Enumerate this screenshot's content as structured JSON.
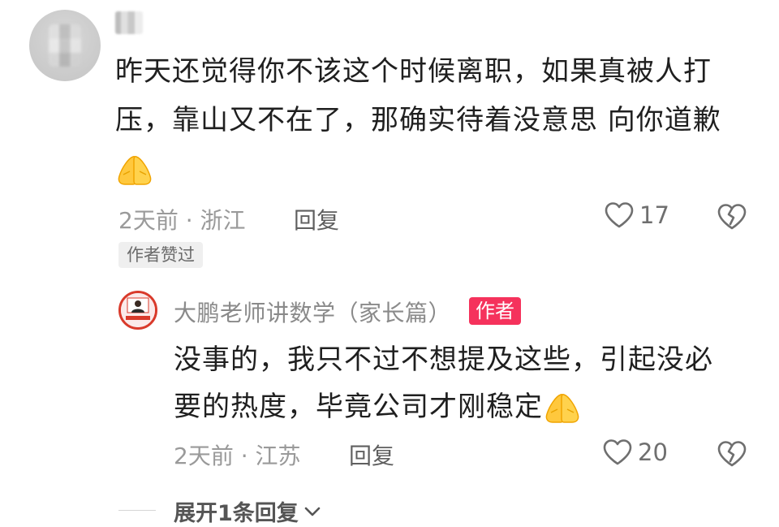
{
  "comment": {
    "text_line1": "昨天还觉得你不该这个时候离职，如果真被人打",
    "text_line2": "压，靠山又不在了，那确实待着没意思 向你道歉",
    "emoji": "folded-hands-emoji",
    "time_location": "2天前 · 浙江",
    "reply_label": "回复",
    "like_count": "17",
    "author_liked": "作者赞过"
  },
  "reply": {
    "author_name": "大鹏老师讲数学（家长篇）",
    "author_tag": "作者",
    "text_line1": "没事的，我只不过不想提及这些，引起没必",
    "text_line2": "要的热度，毕竟公司才刚稳定",
    "emoji": "folded-hands-emoji",
    "time_location": "2天前 · 江苏",
    "reply_label": "回复",
    "like_count": "20"
  },
  "expand": {
    "label": "展开1条回复"
  },
  "colors": {
    "author_tag_bg": "#f5325c",
    "text_primary": "#1f1f1f",
    "text_meta": "#9a9a9a"
  }
}
